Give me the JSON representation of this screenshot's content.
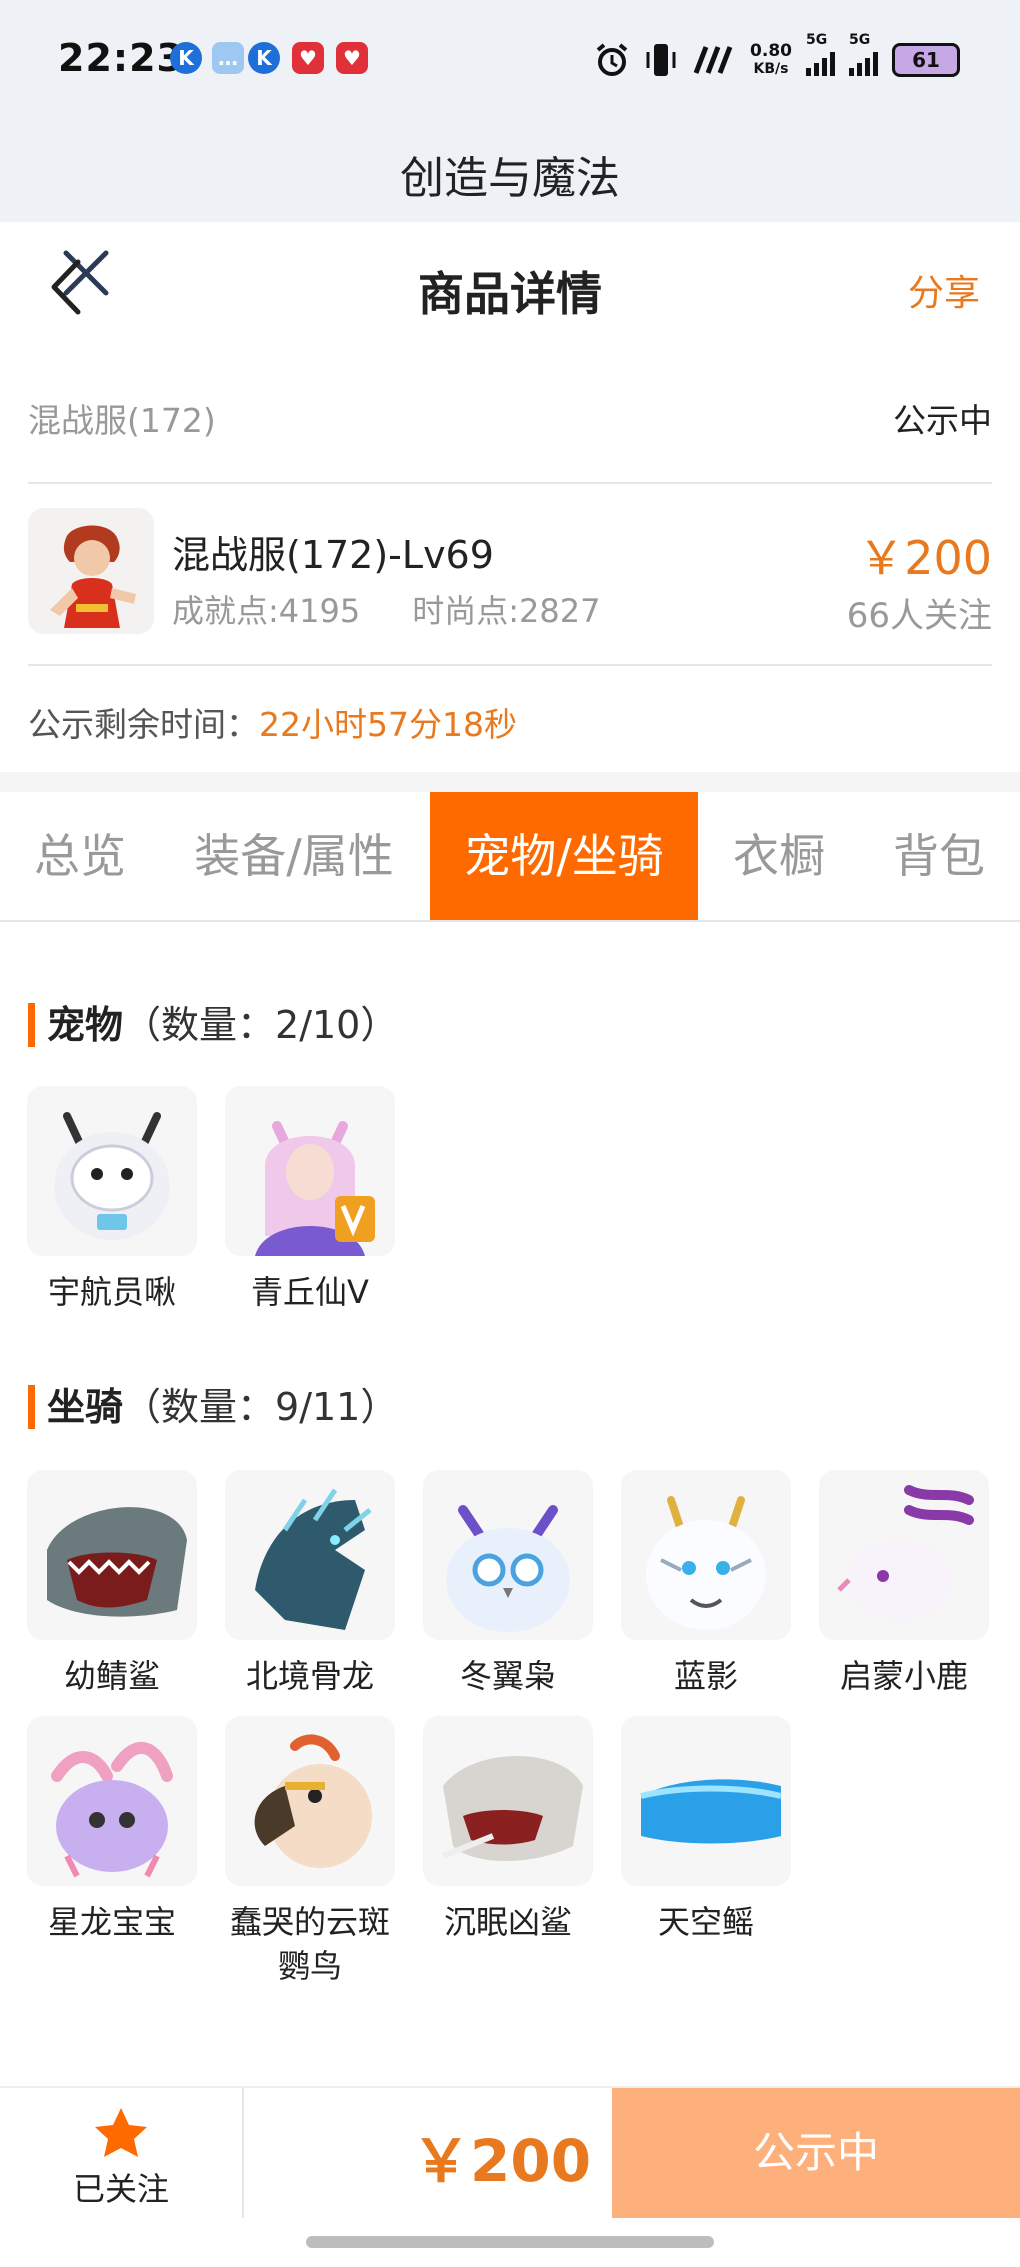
{
  "status_bar": {
    "time": "22:23",
    "net_speed_value": "0.80",
    "net_speed_unit": "KB/s",
    "sim1_label": "5G",
    "sim2_label": "5G",
    "battery": "61"
  },
  "app_header": {
    "title": "创造与魔法"
  },
  "nav": {
    "title": "商品详情",
    "share_label": "分享"
  },
  "server": {
    "name": "混战服(172)",
    "status": "公示中"
  },
  "product": {
    "name": "混战服(172)-Lv69",
    "achievement_label": "成就点:4195",
    "fashion_label": "时尚点:2827",
    "price": "￥200",
    "followers": "66人关注"
  },
  "countdown": {
    "label": "公示剩余时间：",
    "value": "22小时57分18秒"
  },
  "tabs": [
    "总览",
    "装备/属性",
    "宠物/坐骑",
    "衣橱",
    "背包"
  ],
  "pets_section": {
    "title": "宠物",
    "count": "（数量：2/10）",
    "items": [
      "宇航员啾",
      "青丘仙V"
    ]
  },
  "mounts_section": {
    "title": "坐骑",
    "count": "（数量：9/11）",
    "items": [
      "幼鲭鲨",
      "北境骨龙",
      "冬翼枭",
      "蓝影",
      "启蒙小鹿",
      "星龙宝宝",
      "蠢哭的云斑鹦鸟",
      "沉眠凶鲨",
      "天空鳐"
    ]
  },
  "bottom_bar": {
    "follow_label": "已关注",
    "price": "￥200",
    "action_label": "公示中"
  },
  "colors": {
    "accent": "#ff6a00",
    "price": "#e8791f",
    "action_button": "#fdb07b"
  }
}
